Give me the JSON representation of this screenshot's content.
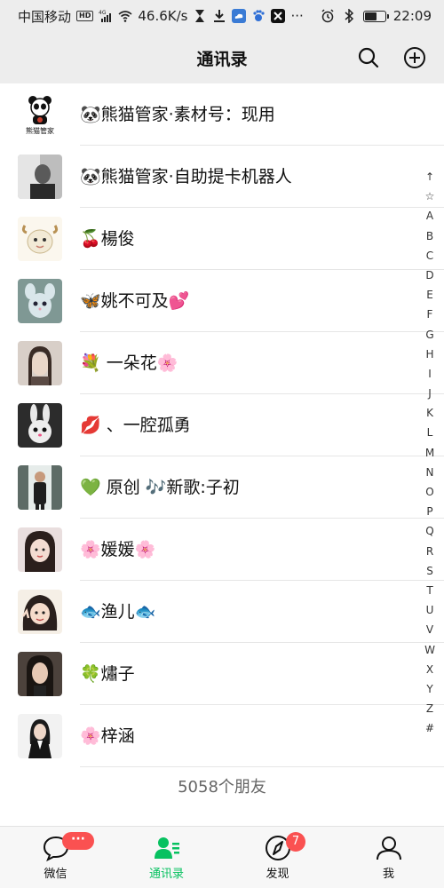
{
  "status_bar": {
    "carrier": "中国移动",
    "hd": "HD",
    "network": "4G",
    "speed": "46.6K/s",
    "time": "22:09",
    "battery_level": 0.6,
    "icons": [
      "hd-icon",
      "signal-icon",
      "wifi-icon",
      "hourglass-icon",
      "download-icon",
      "cloud-icon",
      "baidu-icon",
      "capcut-icon",
      "more-icon",
      "alarm-icon",
      "bluetooth-icon",
      "battery-icon"
    ]
  },
  "header": {
    "title": "通讯录",
    "actions": [
      "search-icon",
      "add-icon"
    ]
  },
  "contacts": [
    {
      "name": "🐼熊猫管家·素材号：现用",
      "avatar_color": "#ffffff",
      "avatar_text": "熊猫管家"
    },
    {
      "name": "🐼熊猫管家·自助提卡机器人",
      "avatar_color": "#9a9a9a",
      "avatar_text": ""
    },
    {
      "name": "🍒楊俊",
      "avatar_color": "#e9e2cf",
      "avatar_text": ""
    },
    {
      "name": "🦋姚不可及💕",
      "avatar_color": "#8aa3a0",
      "avatar_text": ""
    },
    {
      "name": "💐 一朵花🌸",
      "avatar_color": "#b9a394",
      "avatar_text": ""
    },
    {
      "name": "💋 、一腔孤勇",
      "avatar_color": "#3e3e3e",
      "avatar_text": ""
    },
    {
      "name": "💚 原创 🎶新歌:子初",
      "avatar_color": "#6f7a78",
      "avatar_text": ""
    },
    {
      "name": "🌸媛媛🌸",
      "avatar_color": "#c6a8a6",
      "avatar_text": ""
    },
    {
      "name": "🐟渔儿🐟",
      "avatar_color": "#f2ece4",
      "avatar_text": ""
    },
    {
      "name": "🍀熽子",
      "avatar_color": "#5c5048",
      "avatar_text": ""
    },
    {
      "name": "🌸梓涵",
      "avatar_color": "#f4f4f4",
      "avatar_text": ""
    }
  ],
  "friend_count": "5058个朋友",
  "index_bar": [
    "↑",
    "☆",
    "A",
    "B",
    "C",
    "D",
    "E",
    "F",
    "G",
    "H",
    "I",
    "J",
    "K",
    "L",
    "M",
    "N",
    "O",
    "P",
    "Q",
    "R",
    "S",
    "T",
    "U",
    "V",
    "W",
    "X",
    "Y",
    "Z",
    "#"
  ],
  "tabs": [
    {
      "label": "微信",
      "icon": "chat-icon",
      "badge": "···"
    },
    {
      "label": "通讯录",
      "icon": "contacts-icon",
      "active": true
    },
    {
      "label": "发现",
      "icon": "compass-icon",
      "badge": "7"
    },
    {
      "label": "我",
      "icon": "person-icon"
    }
  ],
  "colors": {
    "accent": "#07c160",
    "badge": "#fa5151",
    "header_bg": "#ededed"
  }
}
